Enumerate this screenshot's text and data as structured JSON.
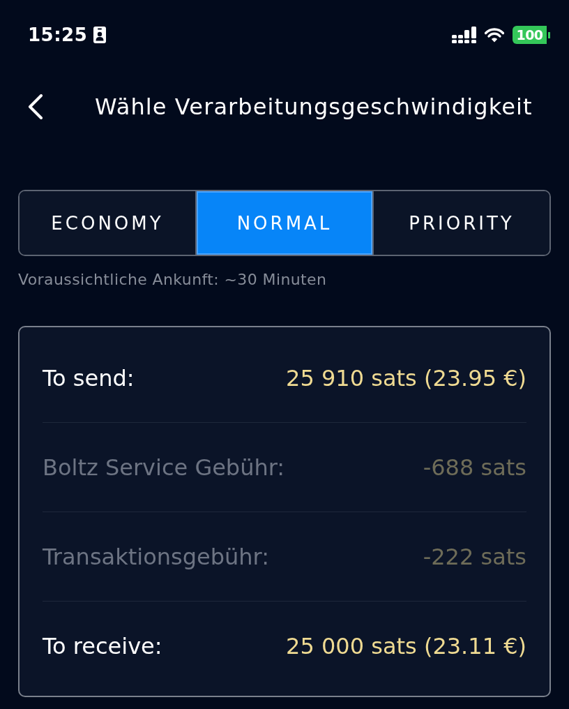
{
  "status_bar": {
    "time": "15:25",
    "battery": "100"
  },
  "header": {
    "title": "Wähle Verarbeitungsgeschwindigkeit"
  },
  "speed_tabs": [
    {
      "label": "ECONOMY",
      "selected": false
    },
    {
      "label": "NORMAL",
      "selected": true
    },
    {
      "label": "PRIORITY",
      "selected": false
    }
  ],
  "eta": "Voraussichtliche Ankunft: ~30 Minuten",
  "summary": {
    "rows": [
      {
        "kind": "total",
        "label": "To send:",
        "value": "25 910 sats (23.95 €)"
      },
      {
        "kind": "fee",
        "label": "Boltz Service Gebühr:",
        "value": "-688 sats"
      },
      {
        "kind": "fee",
        "label": "Transaktionsgebühr:",
        "value": "-222 sats"
      },
      {
        "kind": "total",
        "label": "To receive:",
        "value": "25 000 sats (23.11 €)"
      }
    ]
  }
}
